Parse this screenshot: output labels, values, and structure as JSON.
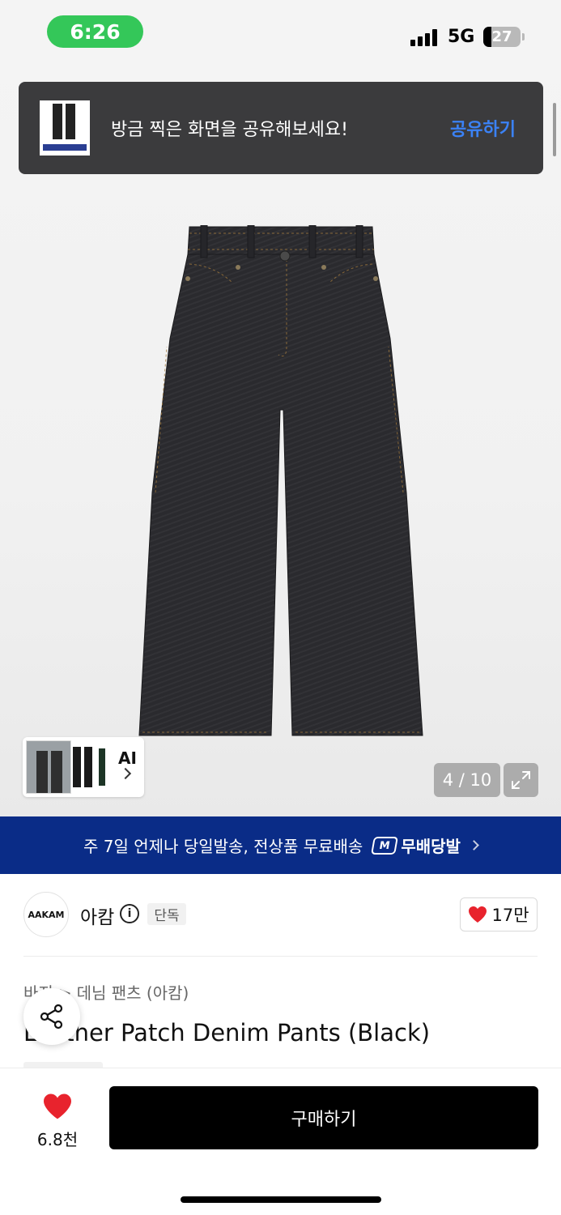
{
  "status_bar": {
    "time": "6:26",
    "network": "5G",
    "battery": "27"
  },
  "toast": {
    "message": "방금 찍은 화면을 공유해보세요!",
    "action": "공유하기"
  },
  "gallery": {
    "ai_label": "AI",
    "counter": "4 / 10"
  },
  "shipping_banner": {
    "text": "주 7일 언제나 당일발송, 전상품 무료배송",
    "logo_mark": "M",
    "logo_text": "무배당발"
  },
  "brand": {
    "logo_text": "AAKAM",
    "name": "아캄",
    "info_glyph": "i",
    "badge": "단독",
    "like_count": "17만"
  },
  "breadcrumb": {
    "cat1": "바지",
    "separator": ">",
    "cat2": "데님 팬츠 (아캄)"
  },
  "product": {
    "title": "Leather Patch Denim Pants (Black)"
  },
  "bottom_bar": {
    "wish_count": "6.8천",
    "buy_label": "구매하기"
  },
  "colors": {
    "accent_link": "#3b82f6",
    "banner_bg": "#0a2c87",
    "heart": "#e8232d",
    "status_green": "#34c759"
  }
}
